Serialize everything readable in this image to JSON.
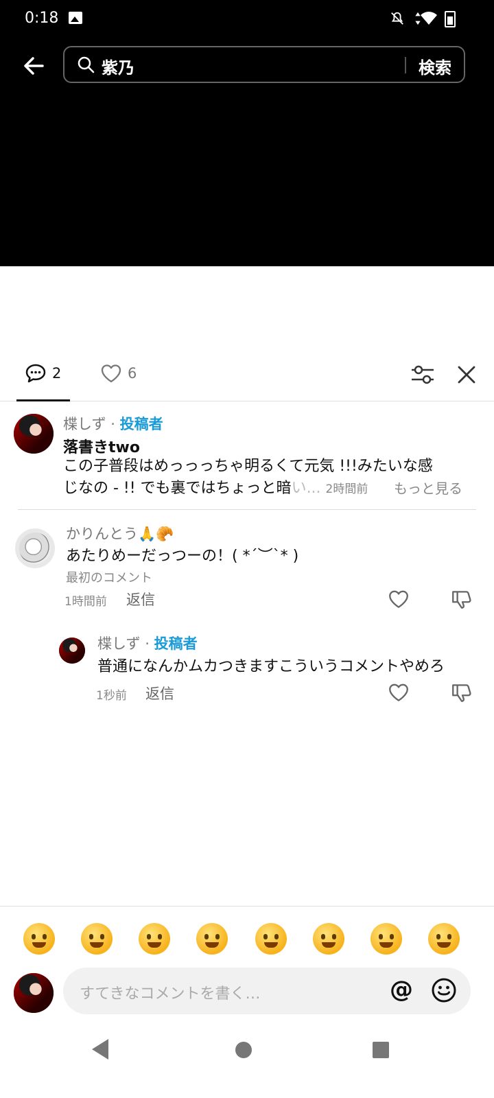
{
  "status_bar": {
    "time": "0:18"
  },
  "search": {
    "query": "紫乃",
    "button_label": "検索"
  },
  "tabs": {
    "comments_count": "2",
    "likes_count": "6"
  },
  "post": {
    "author": "楪しず",
    "separator": "·",
    "author_badge": "投稿者",
    "title": "落書きtwo",
    "body_line1": "この子普段はめっっっちゃ明るくて元気 !!!みたいな感",
    "body_line2": "じなの - !!  でも裏ではちょっと暗",
    "body_fade": "い... ",
    "time": "2時間前",
    "more_label": "もっと見る"
  },
  "comments": [
    {
      "author": "かりんとう🙏🥐",
      "text": "あたりめーだっつーの！( *´︶`* )",
      "badge": "最初のコメント",
      "time": "1時間前",
      "reply_label": "返信"
    },
    {
      "author": "楪しず",
      "separator": "·",
      "author_badge": "投稿者",
      "text": "普通になんかムカつきますこういうコメントやめろ",
      "time": "1秒前",
      "reply_label": "返信"
    }
  ],
  "emoji_bar": [
    "loudly-crying-face",
    "flushed-face",
    "grinning-face",
    "smiling-face-with-hearts",
    "face-with-tears-of-joy",
    "smirking-face",
    "grinning-face-with-sweat",
    "pleading-face"
  ],
  "composer": {
    "placeholder": "すてきなコメントを書く…",
    "at_label": "@"
  },
  "colors": {
    "accent": "#1a9bd7",
    "top_bg": "#000000"
  }
}
